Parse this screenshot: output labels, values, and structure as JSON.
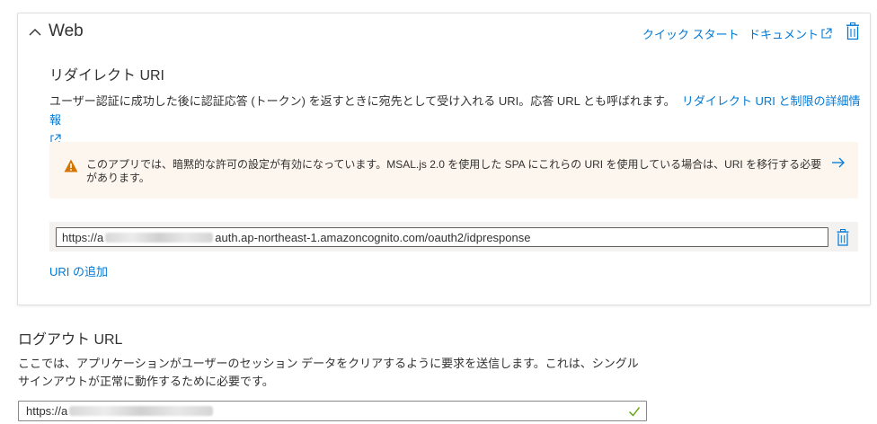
{
  "web_card": {
    "title": "Web",
    "quickstart_label": "クイック スタート",
    "docs_label": "ドキュメント",
    "redirect_section_title": "リダイレクト URI",
    "redirect_description": "ユーザー認証に成功した後に認証応答 (トークン) を返すときに宛先として受け入れる URI。応答 URL とも呼ばれます。",
    "redirect_link_label": "リダイレクト URI と制限の詳細情報",
    "warning_text": "このアプリでは、暗黙的な許可の設定が有効になっています。MSAL.js 2.0 を使用した SPA にこれらの URI を使用している場合は、URI を移行する必要があります。",
    "redirect_uri": {
      "prefix": "https://a",
      "suffix": "auth.ap-northeast-1.amazoncognito.com/oauth2/idpresponse"
    },
    "add_uri_label": "URI の追加"
  },
  "logout": {
    "title": "ログアウト URL",
    "description": "ここでは、アプリケーションがユーザーのセッション データをクリアするように要求を送信します。これは、シングル サインアウトが正常に動作するために必要です。",
    "url_prefix": "https://a"
  },
  "colors": {
    "link": "#0078d4",
    "warning_bg": "#fdf6ee",
    "warning_icon": "#d47500",
    "valid_check": "#57a300"
  },
  "icons": [
    "chevron-up-icon",
    "external-link-icon",
    "trash-icon",
    "warning-icon",
    "arrow-right-icon",
    "checkmark-icon"
  ]
}
